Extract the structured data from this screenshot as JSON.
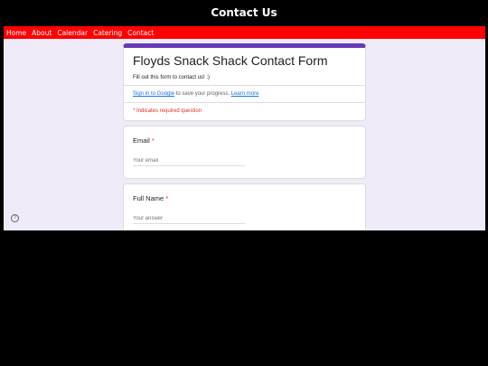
{
  "header": {
    "title": "Contact Us"
  },
  "nav": {
    "items": [
      {
        "label": "Home"
      },
      {
        "label": "About"
      },
      {
        "label": "Calendar"
      },
      {
        "label": "Catering"
      },
      {
        "label": "Contact"
      }
    ]
  },
  "form": {
    "title": "Floyds Snack Shack Contact Form",
    "description": "Fill out this form to contact us! :)",
    "signin_link": "Sign in to Google",
    "signin_text": " to save your progress. ",
    "learn_more": "Learn more",
    "required_note": "* Indicates required question",
    "questions": [
      {
        "label": "Email",
        "required_mark": "*",
        "placeholder": "Your email"
      },
      {
        "label": "Full Name",
        "required_mark": "*",
        "placeholder": "Your answer"
      }
    ]
  },
  "help_icon": {
    "glyph": "?"
  },
  "colors": {
    "nav_bar": "#ff0000",
    "accent": "#673ab7",
    "form_background": "#f0ebf8",
    "required": "#d93025",
    "link": "#1a73e8"
  }
}
